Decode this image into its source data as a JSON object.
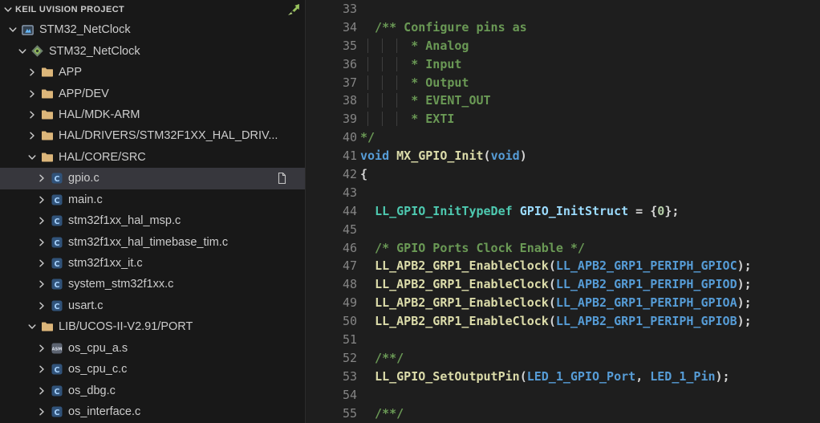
{
  "colors": {
    "sidebar_bg": "#181818",
    "editor_bg": "#1e1e1e",
    "selected_row_bg": "#37373d",
    "sidebar_text": "#cccccc",
    "line_number": "#858585",
    "indent_guide": "#404040",
    "folder_icon": "#dcb67a",
    "keil_green": "#97c15c",
    "syntax": {
      "comment": "#6a9955",
      "keyword": "#569cd6",
      "function": "#dcdcaa",
      "type": "#4ec9b0",
      "variable": "#9cdcfe",
      "number": "#b5cea8",
      "macro": "#569cd6",
      "plain": "#d4d4d4"
    }
  },
  "sidebar": {
    "header": {
      "label": "KEIL UVISION PROJECT",
      "chevron": "down",
      "icon": "keil"
    },
    "tree": [
      {
        "label": "STM32_NetClock",
        "level": 0,
        "chevron": "down",
        "icon": "uvision-project"
      },
      {
        "label": "STM32_NetClock",
        "level": 1,
        "chevron": "down",
        "icon": "keil-target"
      },
      {
        "label": "APP",
        "level": 2,
        "chevron": "right",
        "icon": "folder"
      },
      {
        "label": "APP/DEV",
        "level": 2,
        "chevron": "right",
        "icon": "folder"
      },
      {
        "label": "HAL/MDK-ARM",
        "level": 2,
        "chevron": "right",
        "icon": "folder"
      },
      {
        "label": "HAL/DRIVERS/STM32F1XX_HAL_DRIV...",
        "level": 2,
        "chevron": "right",
        "icon": "folder"
      },
      {
        "label": "HAL/CORE/SRC",
        "level": 2,
        "chevron": "down",
        "icon": "folder"
      },
      {
        "label": "gpio.c",
        "level": 3,
        "chevron": "right",
        "icon": "c-file",
        "selected": true,
        "action_icon": "open-file"
      },
      {
        "label": "main.c",
        "level": 3,
        "chevron": "right",
        "icon": "c-file"
      },
      {
        "label": "stm32f1xx_hal_msp.c",
        "level": 3,
        "chevron": "right",
        "icon": "c-file"
      },
      {
        "label": "stm32f1xx_hal_timebase_tim.c",
        "level": 3,
        "chevron": "right",
        "icon": "c-file"
      },
      {
        "label": "stm32f1xx_it.c",
        "level": 3,
        "chevron": "right",
        "icon": "c-file"
      },
      {
        "label": "system_stm32f1xx.c",
        "level": 3,
        "chevron": "right",
        "icon": "c-file"
      },
      {
        "label": "usart.c",
        "level": 3,
        "chevron": "right",
        "icon": "c-file"
      },
      {
        "label": "LIB/UCOS-II-V2.91/PORT",
        "level": 2,
        "chevron": "down",
        "icon": "folder"
      },
      {
        "label": "os_cpu_a.s",
        "level": 3,
        "chevron": "right",
        "icon": "asm-file"
      },
      {
        "label": "os_cpu_c.c",
        "level": 3,
        "chevron": "right",
        "icon": "c-file"
      },
      {
        "label": "os_dbg.c",
        "level": 3,
        "chevron": "right",
        "icon": "c-file"
      },
      {
        "label": "os_interface.c",
        "level": 3,
        "chevron": "right",
        "icon": "c-file"
      }
    ]
  },
  "editor": {
    "lines": [
      {
        "num": "33",
        "tokens": []
      },
      {
        "num": "34",
        "tokens": [
          {
            "c": "comment",
            "t": "  /** Configure pins as"
          }
        ]
      },
      {
        "num": "35",
        "tokens": [
          {
            "c": "ws",
            "t": " "
          },
          {
            "c": "guide",
            "t": "      "
          },
          {
            "c": "comment",
            "t": "* Analog"
          }
        ]
      },
      {
        "num": "36",
        "tokens": [
          {
            "c": "ws",
            "t": " "
          },
          {
            "c": "guide",
            "t": "      "
          },
          {
            "c": "comment",
            "t": "* Input"
          }
        ]
      },
      {
        "num": "37",
        "tokens": [
          {
            "c": "ws",
            "t": " "
          },
          {
            "c": "guide",
            "t": "      "
          },
          {
            "c": "comment",
            "t": "* Output"
          }
        ]
      },
      {
        "num": "38",
        "tokens": [
          {
            "c": "ws",
            "t": " "
          },
          {
            "c": "guide",
            "t": "      "
          },
          {
            "c": "comment",
            "t": "* EVENT_OUT"
          }
        ]
      },
      {
        "num": "39",
        "tokens": [
          {
            "c": "ws",
            "t": " "
          },
          {
            "c": "guide",
            "t": "      "
          },
          {
            "c": "comment",
            "t": "* EXTI"
          }
        ]
      },
      {
        "num": "40",
        "tokens": [
          {
            "c": "comment",
            "t": "*/"
          }
        ]
      },
      {
        "num": "41",
        "tokens": [
          {
            "c": "keyword",
            "t": "void"
          },
          {
            "c": "plain",
            "t": " "
          },
          {
            "c": "func",
            "t": "MX_GPIO_Init"
          },
          {
            "c": "plain",
            "t": "("
          },
          {
            "c": "keyword",
            "t": "void"
          },
          {
            "c": "plain",
            "t": ")"
          }
        ]
      },
      {
        "num": "42",
        "tokens": [
          {
            "c": "plain",
            "t": "{"
          }
        ]
      },
      {
        "num": "43",
        "tokens": []
      },
      {
        "num": "44",
        "tokens": [
          {
            "c": "plain",
            "t": "  "
          },
          {
            "c": "type",
            "t": "LL_GPIO_InitTypeDef"
          },
          {
            "c": "plain",
            "t": " "
          },
          {
            "c": "var",
            "t": "GPIO_InitStruct"
          },
          {
            "c": "plain",
            "t": " = {"
          },
          {
            "c": "num",
            "t": "0"
          },
          {
            "c": "plain",
            "t": "};"
          }
        ]
      },
      {
        "num": "45",
        "tokens": []
      },
      {
        "num": "46",
        "tokens": [
          {
            "c": "comment",
            "t": "  /* GPIO Ports Clock Enable */"
          }
        ]
      },
      {
        "num": "47",
        "tokens": [
          {
            "c": "plain",
            "t": "  "
          },
          {
            "c": "func",
            "t": "LL_APB2_GRP1_EnableClock"
          },
          {
            "c": "plain",
            "t": "("
          },
          {
            "c": "const",
            "t": "LL_APB2_GRP1_PERIPH_GPIOC"
          },
          {
            "c": "plain",
            "t": ");"
          }
        ]
      },
      {
        "num": "48",
        "tokens": [
          {
            "c": "plain",
            "t": "  "
          },
          {
            "c": "func",
            "t": "LL_APB2_GRP1_EnableClock"
          },
          {
            "c": "plain",
            "t": "("
          },
          {
            "c": "const",
            "t": "LL_APB2_GRP1_PERIPH_GPIOD"
          },
          {
            "c": "plain",
            "t": ");"
          }
        ]
      },
      {
        "num": "49",
        "tokens": [
          {
            "c": "plain",
            "t": "  "
          },
          {
            "c": "func",
            "t": "LL_APB2_GRP1_EnableClock"
          },
          {
            "c": "plain",
            "t": "("
          },
          {
            "c": "const",
            "t": "LL_APB2_GRP1_PERIPH_GPIOA"
          },
          {
            "c": "plain",
            "t": ");"
          }
        ]
      },
      {
        "num": "50",
        "tokens": [
          {
            "c": "plain",
            "t": "  "
          },
          {
            "c": "func",
            "t": "LL_APB2_GRP1_EnableClock"
          },
          {
            "c": "plain",
            "t": "("
          },
          {
            "c": "const",
            "t": "LL_APB2_GRP1_PERIPH_GPIOB"
          },
          {
            "c": "plain",
            "t": ");"
          }
        ]
      },
      {
        "num": "51",
        "tokens": []
      },
      {
        "num": "52",
        "tokens": [
          {
            "c": "comment",
            "t": "  /**/"
          }
        ]
      },
      {
        "num": "53",
        "tokens": [
          {
            "c": "plain",
            "t": "  "
          },
          {
            "c": "func",
            "t": "LL_GPIO_SetOutputPin"
          },
          {
            "c": "plain",
            "t": "("
          },
          {
            "c": "const",
            "t": "LED_1_GPIO_Port"
          },
          {
            "c": "plain",
            "t": ", "
          },
          {
            "c": "const",
            "t": "LED_1_Pin"
          },
          {
            "c": "plain",
            "t": ");"
          }
        ]
      },
      {
        "num": "54",
        "tokens": []
      },
      {
        "num": "55",
        "tokens": [
          {
            "c": "comment",
            "t": "  /**/"
          }
        ]
      }
    ]
  }
}
